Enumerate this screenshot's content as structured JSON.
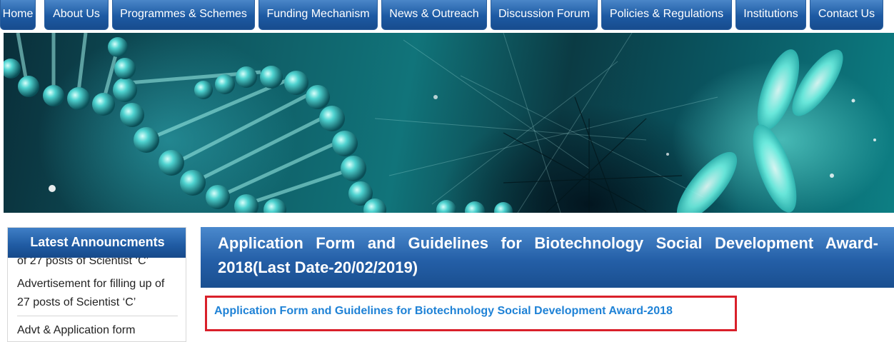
{
  "nav": {
    "items": [
      {
        "label": "Home"
      },
      {
        "label": "About Us"
      },
      {
        "label": "Programmes & Schemes"
      },
      {
        "label": "Funding Mechanism"
      },
      {
        "label": "News & Outreach"
      },
      {
        "label": "Discussion Forum"
      },
      {
        "label": "Policies & Regulations"
      },
      {
        "label": "Institutions"
      },
      {
        "label": "Contact Us"
      }
    ]
  },
  "banner": {
    "image": "dna-helix-chromosome-banner",
    "colors": {
      "base": "#0b4a55",
      "glow": "#7ff5ea"
    }
  },
  "sidebar": {
    "title": "Latest Announcments",
    "items": [
      {
        "text": "of 27 posts of Scientist ‘C’"
      },
      {
        "text": "Advertisement for filling up of 27 posts of Scientist ‘C’"
      },
      {
        "text": "Advt & Application form"
      }
    ]
  },
  "main": {
    "title": "Application Form and Guidelines for Biotechnology Social Development Award- 2018(Last Date-20/02/2019)",
    "link": "Application Form and Guidelines for Biotechnology Social Development Award-2018"
  },
  "colors": {
    "nav_blue": "#1d5aa3",
    "link_blue": "#1f82d6",
    "highlight_red": "#d9202a"
  }
}
